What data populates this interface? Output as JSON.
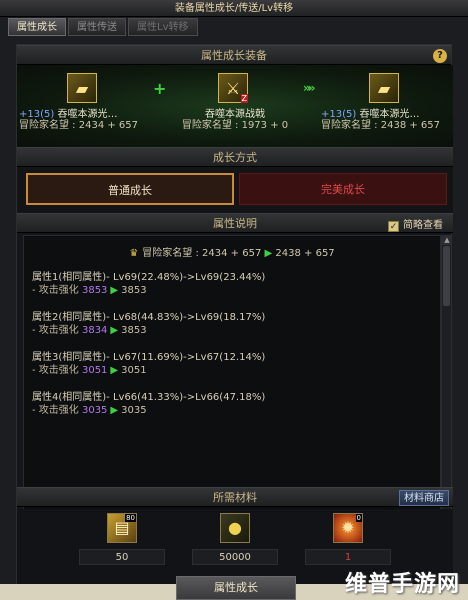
{
  "window": {
    "title": "装备属性成长/传送/Lv转移"
  },
  "tabs": [
    {
      "label": "属性成长"
    },
    {
      "label": "属性传送"
    },
    {
      "label": "属性Lv转移"
    }
  ],
  "equip": {
    "header": "属性成长装备",
    "left": {
      "level": "+13(5)",
      "name": "吞噬本源光…",
      "rep_label": "冒险家名望 : ",
      "rep_value": "2434 + 657"
    },
    "middle": {
      "name": "吞噬本源战戟",
      "rep_label": "冒险家名望 : ",
      "rep_value": "1973 + 0",
      "badge": "Z"
    },
    "right": {
      "level": "+13(5)",
      "name": "吞噬本源光…",
      "rep_label": "冒险家名望 : ",
      "rep_value": "2438 + 657"
    },
    "help": "?"
  },
  "modes": {
    "header": "成长方式",
    "normal": "普通成长",
    "perfect": "完美成长"
  },
  "description": {
    "header": "属性说明",
    "checkbox_label": "简略查看",
    "reputation": {
      "label": "冒险家名望 : ",
      "before": "2434 + 657",
      "after": "2438 + 657"
    },
    "attributes": [
      {
        "title": "属性1(相同属性)- Lv69(22.48%)->Lv69(23.44%)",
        "stat": "- 攻击强化 ",
        "before": "3853",
        "after": "3853"
      },
      {
        "title": "属性2(相同属性)- Lv68(44.83%)->Lv69(18.17%)",
        "stat": "- 攻击强化 ",
        "before": "3834",
        "after": "3853"
      },
      {
        "title": "属性3(相同属性)- Lv67(11.69%)->Lv67(12.14%)",
        "stat": "- 攻击强化 ",
        "before": "3051",
        "after": "3051"
      },
      {
        "title": "属性4(相同属性)- Lv66(41.33%)->Lv66(47.18%)",
        "stat": "- 攻击强化 ",
        "before": "3035",
        "after": "3035"
      }
    ]
  },
  "materials": {
    "header": "所需材料",
    "shop": "材料商店",
    "items": [
      {
        "count": "80",
        "qty": "50"
      },
      {
        "count": "",
        "qty": "50000"
      },
      {
        "count": "0",
        "qty": "1"
      }
    ]
  },
  "bottom_button": "属性成长",
  "watermark": "维普手游网"
}
